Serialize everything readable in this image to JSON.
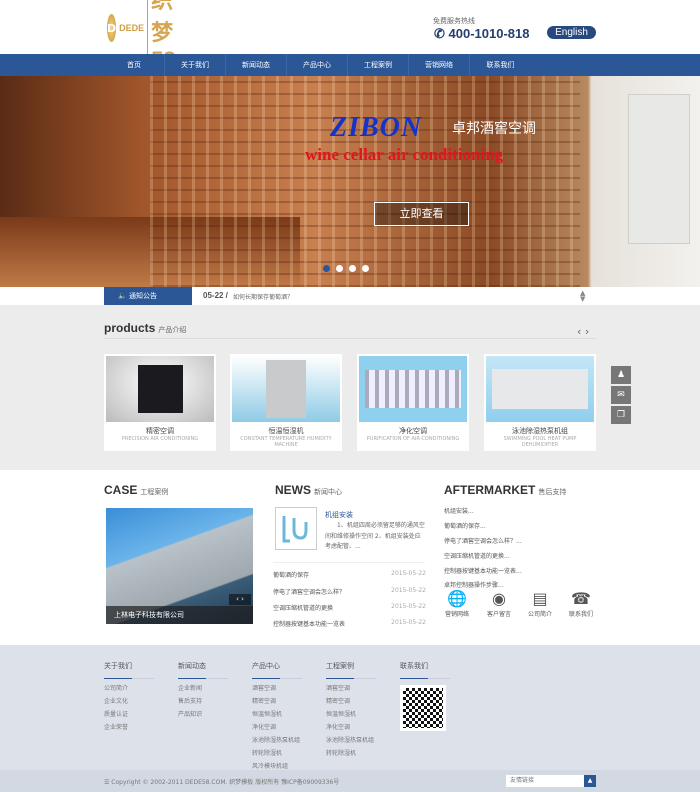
{
  "header": {
    "logo_text": "DEDE 织梦58",
    "logo_sub": "DEDE",
    "logo_brand": "织梦58",
    "hotline_label": "免费服务热线",
    "hotline": "400-1010-818",
    "english": "English"
  },
  "nav": [
    "首页",
    "关于我们",
    "新闻动态",
    "产品中心",
    "工程案例",
    "营销网络",
    "联系我们"
  ],
  "banner": {
    "brand": "ZIBON",
    "brand_cn": "卓邦酒窖空调",
    "tagline": "wine cellar air conditioning",
    "button": "立即查看",
    "slides": 4,
    "active_slide": 1
  },
  "notice": {
    "label": "通知公告",
    "date": "05-22 /",
    "text": "如何长期保存葡萄酒？"
  },
  "products": {
    "title": "products",
    "subtitle": "产品介绍",
    "items": [
      {
        "cn": "精密空调",
        "en": "PRECISION AIR CONDITIONING"
      },
      {
        "cn": "恒温恒湿机",
        "en": "CONSTANT TEMPERATURE HUMIDITY MACHINE"
      },
      {
        "cn": "净化空调",
        "en": "PURIFICATION OF AIR-CONDITIONING"
      },
      {
        "cn": "泳池除湿热泵机组",
        "en": "SWIMMING POOL HEAT PUMP DEHUMIDIFIER"
      }
    ]
  },
  "case": {
    "title": "CASE",
    "subtitle": "工程案例",
    "caption": "上林电子科技有限公司"
  },
  "news": {
    "title": "NEWS",
    "subtitle": "新闻中心",
    "featured_title": "机组安装",
    "featured_desc": "1、机组四周必须留足够的通风空间和维修操作空间 2、机组安装处应考虑配管、...",
    "items": [
      {
        "title": "葡萄酒的保存",
        "date": "2015-05-22"
      },
      {
        "title": "停电了酒窖空调会怎么样？",
        "date": "2015-05-22"
      },
      {
        "title": "空调压缩机管道的更换",
        "date": "2015-05-22"
      },
      {
        "title": "控制器按键基本功能一览表",
        "date": "2015-05-22"
      }
    ]
  },
  "aftermarket": {
    "title": "AFTERMARKET",
    "subtitle": "售后支持",
    "items": [
      "机组安装...",
      "葡萄酒的保存...",
      "停电了酒窖空调会怎么样？...",
      "空调压缩机管道的更换...",
      "控制器按键基本功能一览表...",
      "卓邦控制器操作步骤..."
    ],
    "icons": [
      {
        "label": "营销网络",
        "icon": "globe-icon"
      },
      {
        "label": "客户留言",
        "icon": "message-icon"
      },
      {
        "label": "公司简介",
        "icon": "profile-icon"
      },
      {
        "label": "联系我们",
        "icon": "phone-icon"
      }
    ]
  },
  "footer": {
    "columns": [
      {
        "title": "关于我们",
        "links": [
          "公司简介",
          "企业文化",
          "质量认证",
          "企业荣誉"
        ]
      },
      {
        "title": "新闻动态",
        "links": [
          "企业新闻",
          "售后支持",
          "产品知识"
        ]
      },
      {
        "title": "产品中心",
        "links": [
          "酒窖空调",
          "精密空调",
          "恒温恒湿机",
          "净化空调",
          "泳池除湿热泵机组",
          "转轮除湿机",
          "风冷模块机组"
        ]
      },
      {
        "title": "工程案例",
        "links": [
          "酒窖空调",
          "精密空调",
          "恒温恒湿机",
          "净化空调",
          "泳池除湿热泵机组",
          "转轮除湿机"
        ]
      },
      {
        "title": "联系我们",
        "links": []
      }
    ],
    "copyright": "Copyright © 2002-2011 DEDE58.COM. 织梦模板 版权所有 豫ICP备09009336号",
    "links_select": "友情链接"
  },
  "colors": {
    "primary": "#2b5797",
    "gray_bg": "#ececec",
    "footer_bg": "#dde2ea"
  }
}
